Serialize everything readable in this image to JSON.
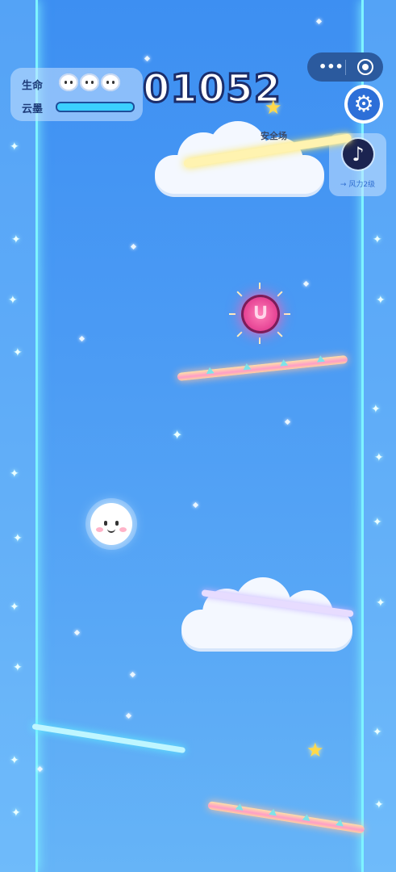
{
  "hud": {
    "life_label": "生命",
    "ink_label": "云墨",
    "lives": 3,
    "ink_level": 1.0
  },
  "score": "01052",
  "miniprogram": {
    "more_icon": "more-dots-icon",
    "close_icon": "target-icon"
  },
  "settings": {
    "icon": "gear-icon"
  },
  "music": {
    "icon": "music-note-icon",
    "wind_label": "→ 风力2级"
  },
  "zone": {
    "safe_label": "安全场"
  },
  "colors": {
    "background_top": "#3d8ff2",
    "wall_glow": "#7ef3ff",
    "score_outline": "#1b2d6b",
    "gold_bar": "#ffe34a",
    "magnet": "#e23a8f"
  }
}
